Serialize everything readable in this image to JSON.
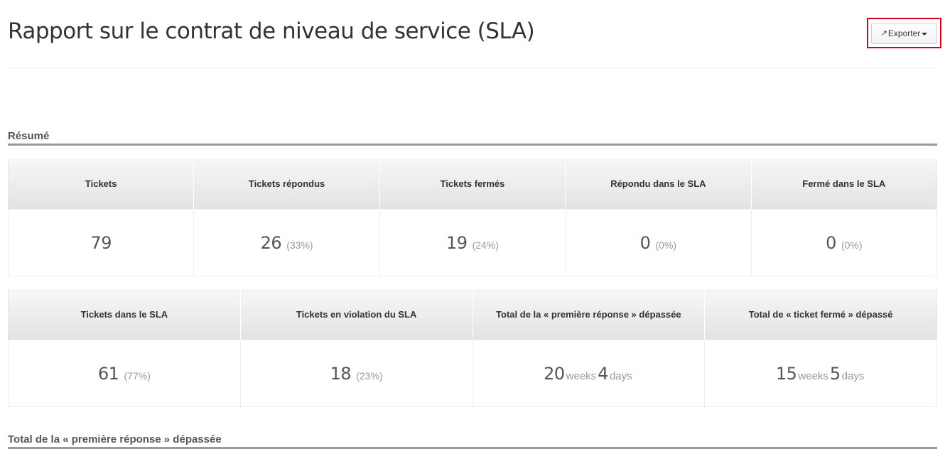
{
  "header": {
    "title": "Rapport sur le contrat de niveau de service (SLA)",
    "export_label": "Exporter",
    "export_icon": "share-icon",
    "caret_icon": "caret-down-icon"
  },
  "summary": {
    "heading": "Résumé",
    "row1": {
      "columns": [
        "Tickets",
        "Tickets répondus",
        "Tickets fermés",
        "Répondu dans le SLA",
        "Fermé dans le SLA"
      ],
      "cells": [
        {
          "value": "79",
          "sub": ""
        },
        {
          "value": "26",
          "sub": "(33%)"
        },
        {
          "value": "19",
          "sub": "(24%)"
        },
        {
          "value": "0",
          "sub": "(0%)"
        },
        {
          "value": "0",
          "sub": "(0%)"
        }
      ]
    },
    "row2": {
      "columns": [
        "Tickets dans le SLA",
        "Tickets en violation du SLA",
        "Total de la « première réponse » dépassée",
        "Total de « ticket fermé » dépassé"
      ],
      "cells": [
        {
          "value": "61",
          "sub": "(77%)"
        },
        {
          "value": "18",
          "sub": "(23%)"
        },
        {
          "weeks": "20",
          "weeks_label": "weeks",
          "days": "4",
          "days_label": "days"
        },
        {
          "weeks": "15",
          "weeks_label": "weeks",
          "days": "5",
          "days_label": "days"
        }
      ]
    }
  },
  "next_section": {
    "heading": "Total de la « première réponse » dépassée"
  }
}
